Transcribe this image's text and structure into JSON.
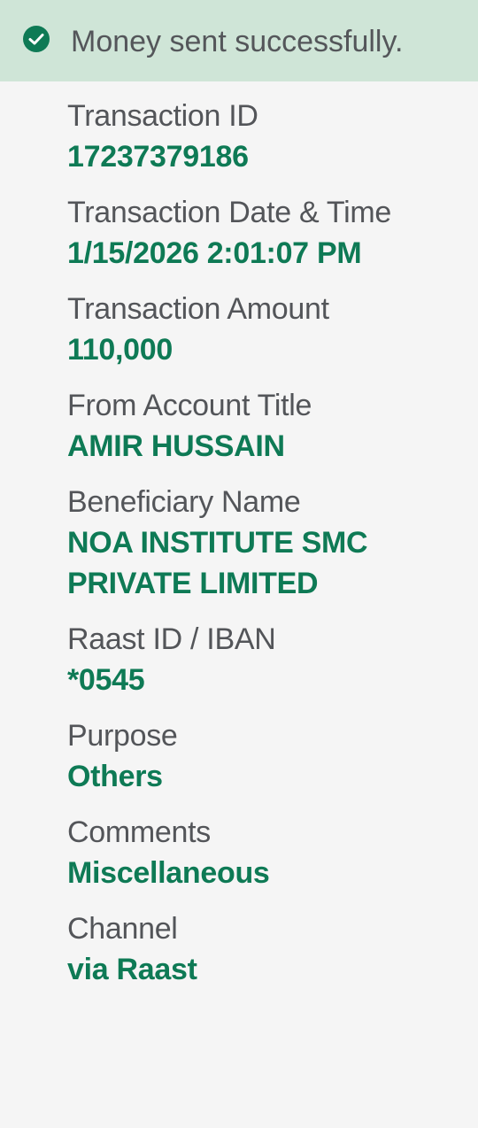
{
  "banner": {
    "message": "Money sent successfully.",
    "icon": "check-circle-icon",
    "background": "#cfe5d7",
    "icon_color": "#0e7a55"
  },
  "colors": {
    "label": "#535559",
    "value": "#0e7a55",
    "page_background": "#f5f5f5"
  },
  "details": [
    {
      "name": "transaction-id",
      "label": "Transaction ID",
      "value": "17237379186"
    },
    {
      "name": "transaction-date-time",
      "label": "Transaction Date & Time",
      "value": "1/15/2026 2:01:07 PM"
    },
    {
      "name": "transaction-amount",
      "label": "Transaction Amount",
      "value": "110,000"
    },
    {
      "name": "from-account-title",
      "label": "From Account Title",
      "value": "AMIR HUSSAIN"
    },
    {
      "name": "beneficiary-name",
      "label": "Beneficiary Name",
      "value": "NOA INSTITUTE SMC PRIVATE LIMITED"
    },
    {
      "name": "raast-id-iban",
      "label": "Raast ID / IBAN",
      "value": "*0545"
    },
    {
      "name": "purpose",
      "label": "Purpose",
      "value": "Others"
    },
    {
      "name": "comments",
      "label": "Comments",
      "value": "Miscellaneous"
    },
    {
      "name": "channel",
      "label": "Channel",
      "value": "via Raast"
    }
  ]
}
